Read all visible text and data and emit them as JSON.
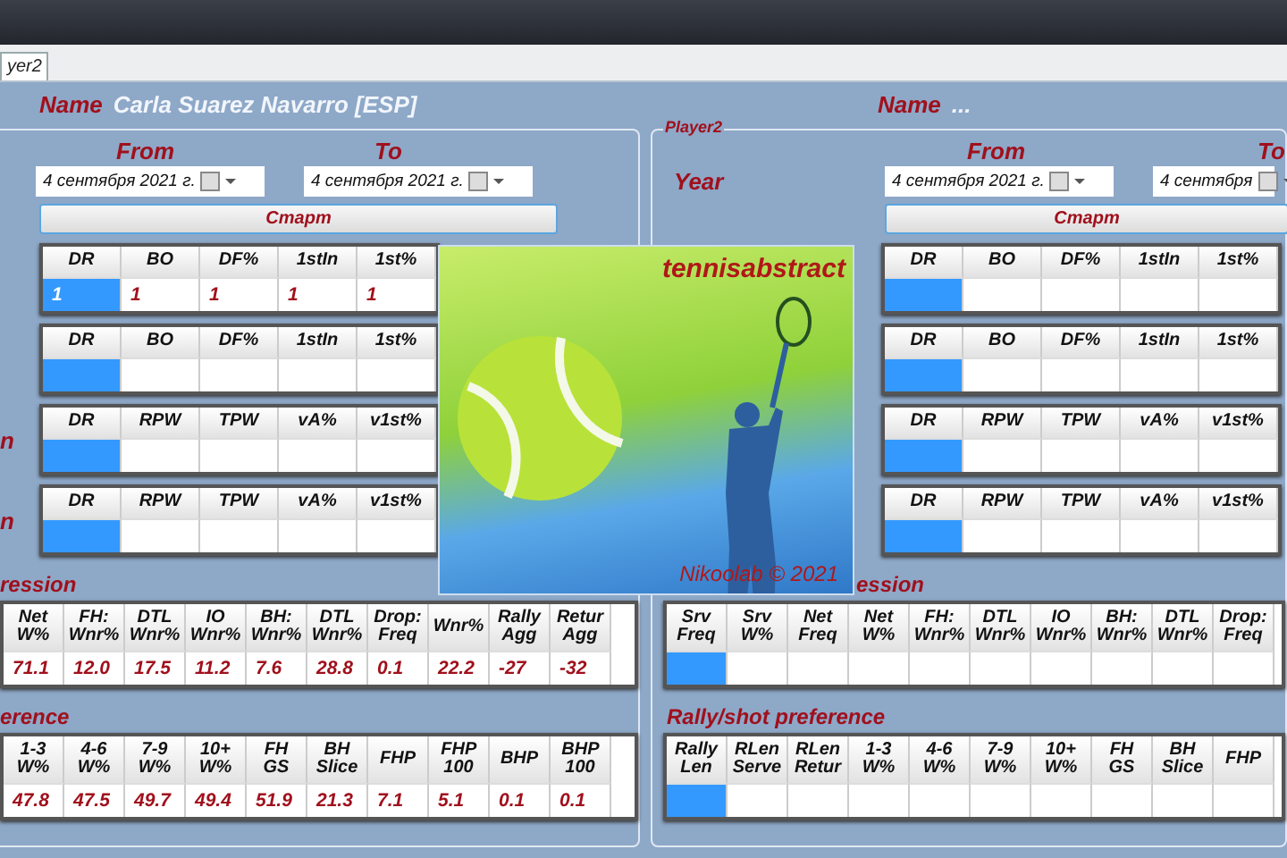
{
  "tab": {
    "label": "yer2",
    "selected": true
  },
  "player1": {
    "name_label": "Name",
    "name": "Carla Suarez Navarro [ESP]",
    "from_label": "From",
    "to_label": "To",
    "from_date": "4 сентября 2021 г.",
    "to_date": "4 сентября 2021 г.",
    "start_button": "Старт",
    "tables": [
      {
        "columns": [
          "DR",
          "BO",
          "DF%",
          "1stIn",
          "1st%"
        ],
        "cells": [
          {
            "value": "1",
            "selected": true
          },
          {
            "value": "1",
            "selected": false
          },
          {
            "value": "1",
            "selected": false
          },
          {
            "value": "1",
            "selected": false
          },
          {
            "value": "1",
            "selected": false
          }
        ]
      },
      {
        "columns": [
          "DR",
          "BO",
          "DF%",
          "1stIn",
          "1st%"
        ],
        "cells": [
          {
            "selected": true
          },
          {
            "selected": false
          },
          {
            "selected": false
          },
          {
            "selected": false
          },
          {
            "selected": false
          }
        ]
      },
      {
        "row_label": "n",
        "columns": [
          "DR",
          "RPW",
          "TPW",
          "vA%",
          "v1st%"
        ],
        "cells": [
          {
            "selected": true
          },
          {
            "selected": false
          },
          {
            "selected": false
          },
          {
            "selected": false
          },
          {
            "selected": false
          }
        ]
      },
      {
        "row_label": "n",
        "columns": [
          "DR",
          "RPW",
          "TPW",
          "vA%",
          "v1st%"
        ],
        "cells": [
          {
            "selected": true
          },
          {
            "selected": false
          },
          {
            "selected": false
          },
          {
            "selected": false
          },
          {
            "selected": false
          }
        ]
      }
    ],
    "sections": [
      {
        "title": "ression",
        "columns": [
          "Net W%",
          "FH: Wnr%",
          "DTL Wnr%",
          "IO Wnr%",
          "BH: Wnr%",
          "DTL Wnr%",
          "Drop: Freq",
          "Wnr%",
          "Rally Agg",
          "Retur Agg"
        ],
        "cells": [
          {
            "value": "71.1",
            "selected": false
          },
          {
            "value": "12.0",
            "selected": false
          },
          {
            "value": "17.5",
            "selected": false
          },
          {
            "value": "11.2",
            "selected": false
          },
          {
            "value": "7.6",
            "selected": false
          },
          {
            "value": "28.8",
            "selected": false
          },
          {
            "value": "0.1",
            "selected": false
          },
          {
            "value": "22.2",
            "selected": false
          },
          {
            "value": "-27",
            "selected": false
          },
          {
            "value": "-32",
            "selected": false
          }
        ]
      },
      {
        "title": "erence",
        "columns": [
          "1-3 W%",
          "4-6 W%",
          "7-9 W%",
          "10+ W%",
          "FH GS",
          "BH Slice",
          "FHP",
          "FHP 100",
          "BHP",
          "BHP 100"
        ],
        "cells": [
          {
            "value": "47.8",
            "selected": false
          },
          {
            "value": "47.5",
            "selected": false
          },
          {
            "value": "49.7",
            "selected": false
          },
          {
            "value": "49.4",
            "selected": false
          },
          {
            "value": "51.9",
            "selected": false
          },
          {
            "value": "21.3",
            "selected": false
          },
          {
            "value": "7.1",
            "selected": false
          },
          {
            "value": "5.1",
            "selected": false
          },
          {
            "value": "0.1",
            "selected": false
          },
          {
            "value": "0.1",
            "selected": false
          }
        ]
      }
    ]
  },
  "player2": {
    "name_label": "Name",
    "name": "...",
    "group_label": "Player2",
    "year_label": "Year",
    "from_label": "From",
    "to_label": "To",
    "from_date": "4 сентября 2021 г.",
    "to_date": "4 сентября",
    "start_button": "Старт",
    "tables": [
      {
        "columns": [
          "DR",
          "BO",
          "DF%",
          "1stIn",
          "1st%"
        ],
        "cells": [
          {
            "selected": true
          },
          {
            "selected": false
          },
          {
            "selected": false
          },
          {
            "selected": false
          },
          {
            "selected": false
          }
        ]
      },
      {
        "columns": [
          "DR",
          "BO",
          "DF%",
          "1stIn",
          "1st%"
        ],
        "cells": [
          {
            "selected": true
          },
          {
            "selected": false
          },
          {
            "selected": false
          },
          {
            "selected": false
          },
          {
            "selected": false
          }
        ]
      },
      {
        "columns": [
          "DR",
          "RPW",
          "TPW",
          "vA%",
          "v1st%"
        ],
        "cells": [
          {
            "selected": true
          },
          {
            "selected": false
          },
          {
            "selected": false
          },
          {
            "selected": false
          },
          {
            "selected": false
          }
        ]
      },
      {
        "columns": [
          "DR",
          "RPW",
          "TPW",
          "vA%",
          "v1st%"
        ],
        "cells": [
          {
            "selected": true
          },
          {
            "selected": false
          },
          {
            "selected": false
          },
          {
            "selected": false
          },
          {
            "selected": false
          }
        ]
      }
    ],
    "sections": [
      {
        "title": "ession",
        "columns": [
          "Srv Freq",
          "Srv W%",
          "Net Freq",
          "Net W%",
          "FH: Wnr%",
          "DTL Wnr%",
          "IO Wnr%",
          "BH: Wnr%",
          "DTL Wnr%",
          "Drop: Freq"
        ],
        "cells": [
          {
            "selected": true
          },
          {
            "selected": false
          },
          {
            "selected": false
          },
          {
            "selected": false
          },
          {
            "selected": false
          },
          {
            "selected": false
          },
          {
            "selected": false
          },
          {
            "selected": false
          },
          {
            "selected": false
          },
          {
            "selected": false
          }
        ]
      },
      {
        "title": "Rally/shot preference",
        "columns": [
          "Rally Len",
          "RLen Serve",
          "RLen Retur",
          "1-3 W%",
          "4-6 W%",
          "7-9 W%",
          "10+ W%",
          "FH GS",
          "BH Slice",
          "FHP"
        ],
        "cells": [
          {
            "selected": true
          },
          {
            "selected": false
          },
          {
            "selected": false
          },
          {
            "selected": false
          },
          {
            "selected": false
          },
          {
            "selected": false
          },
          {
            "selected": false
          },
          {
            "selected": false
          },
          {
            "selected": false
          },
          {
            "selected": false
          }
        ]
      }
    ]
  },
  "splash": {
    "brand": "tennisabstract",
    "credit": "Nikoolab © 2021"
  }
}
